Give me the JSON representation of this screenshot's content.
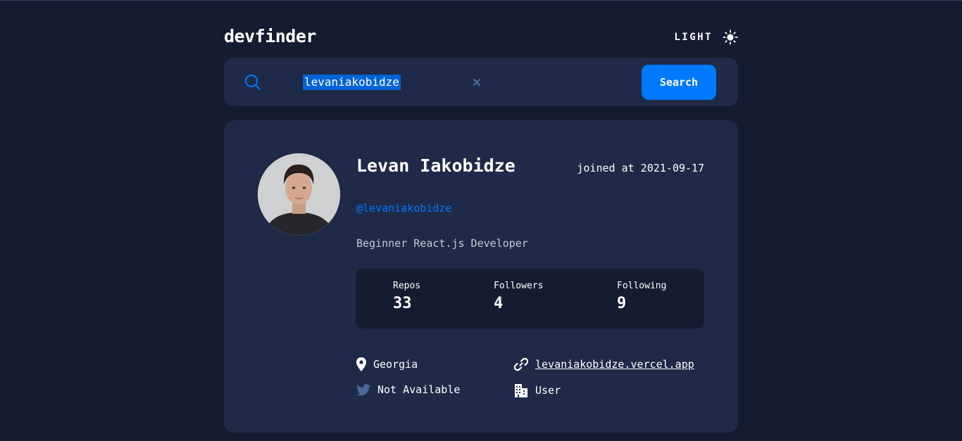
{
  "header": {
    "logo": "devfinder",
    "theme_label": "LIGHT",
    "theme_icon": "sun-icon"
  },
  "search": {
    "value": "levaniakobidze",
    "button_label": "Search",
    "icon": "search-icon",
    "clear_icon": "close-icon"
  },
  "profile": {
    "name": "Levan Iakobidze",
    "joined": "joined at 2021-09-17",
    "login": "@levaniakobidze",
    "bio": "Beginner React.js Developer",
    "stats": {
      "repos_label": "Repos",
      "repos": "33",
      "followers_label": "Followers",
      "followers": "4",
      "following_label": "Following",
      "following": "9"
    },
    "location": "Georgia",
    "twitter": "Not Available",
    "blog": "levaniakobidze.vercel.app",
    "company": "User"
  },
  "colors": {
    "background": "#141d2f",
    "card": "#1e2a47",
    "accent": "#0079ff",
    "text": "#ffffff"
  }
}
